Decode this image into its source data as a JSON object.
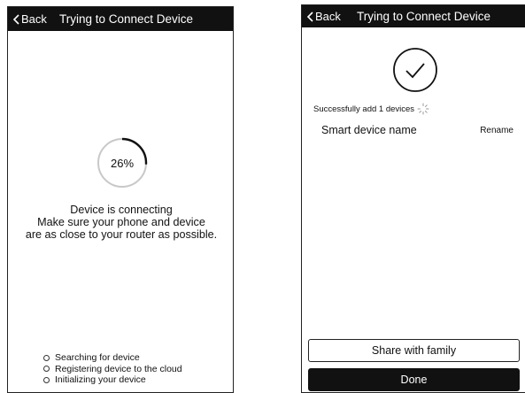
{
  "connecting_screen": {
    "back_label": "Back",
    "title": "Trying to Connect Device",
    "progress": {
      "value": 26,
      "label": "26%"
    },
    "status_lines": [
      "Device is connecting",
      "Make sure your phone and device",
      "are as close to your router as possible."
    ],
    "steps": [
      "Searching for device",
      "Registering device to the cloud",
      "Initializing your device"
    ]
  },
  "success_screen": {
    "back_label": "Back",
    "title": "Trying to Connect Device",
    "success_text": "Successfully add 1 devices",
    "device_name": "Smart device name",
    "rename_label": "Rename",
    "share_button": "Share with family",
    "done_button": "Done"
  },
  "colors": {
    "navbar": "#111111",
    "background": "#ffffff",
    "done_button": "#111111"
  },
  "icons": [
    "chevron-left-icon",
    "checkmark-circle-icon",
    "loading-spinner-icon"
  ]
}
